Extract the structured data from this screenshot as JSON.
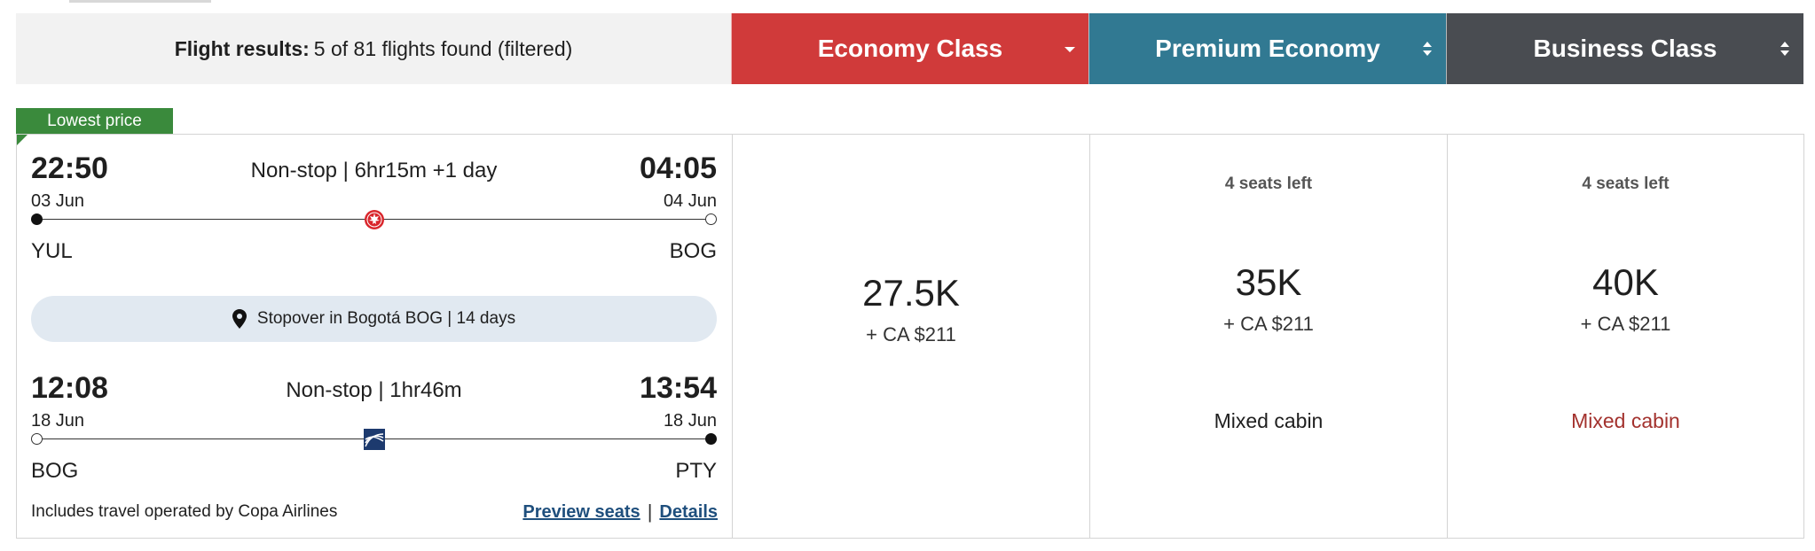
{
  "header": {
    "results_label": "Flight results:",
    "results_text": "5 of 81 flights found (filtered)",
    "cabins": [
      {
        "label": "Economy Class",
        "color": "#d03a3a",
        "sort_icon": "caret-down-icon"
      },
      {
        "label": "Premium Economy",
        "color": "#317992",
        "sort_icon": "sort-updown-icon"
      },
      {
        "label": "Business Class",
        "color": "#494c51",
        "sort_icon": "sort-updown-icon"
      }
    ]
  },
  "flight": {
    "badge": "Lowest price",
    "segments": [
      {
        "dep_time": "22:50",
        "dep_date": "03 Jun",
        "arr_time": "04:05",
        "arr_date": "04 Jun",
        "duration": "Non-stop | 6hr15m +1 day",
        "from": "YUL",
        "to": "BOG",
        "airline_icon": "air-canada-icon"
      },
      {
        "dep_time": "12:08",
        "dep_date": "18 Jun",
        "arr_time": "13:54",
        "arr_date": "18 Jun",
        "duration": "Non-stop | 1hr46m",
        "from": "BOG",
        "to": "PTY",
        "airline_icon": "copa-airlines-icon"
      }
    ],
    "stopover": "Stopover in Bogotá BOG | 14 days",
    "operated_by": "Includes travel operated by Copa Airlines",
    "preview_seats": "Preview seats",
    "link_separator": "|",
    "details": "Details",
    "fares": [
      {
        "cabin": "Economy Class",
        "seats_left": "",
        "points": "27.5K",
        "taxes": "+ CA $211",
        "note": ""
      },
      {
        "cabin": "Premium Economy",
        "seats_left": "4 seats left",
        "points": "35K",
        "taxes": "+ CA $211",
        "note": "Mixed cabin"
      },
      {
        "cabin": "Business Class",
        "seats_left": "4 seats left",
        "points": "40K",
        "taxes": "+ CA $211",
        "note": "Mixed cabin"
      }
    ]
  }
}
